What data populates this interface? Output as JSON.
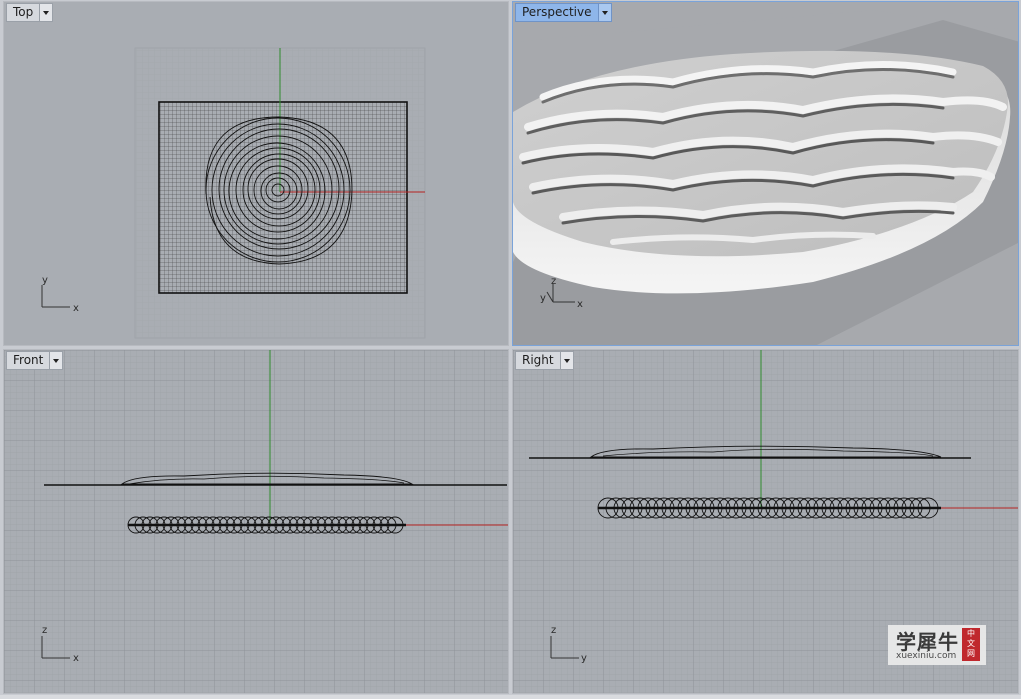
{
  "viewports": {
    "top": {
      "label": "Top",
      "axis_a": "y",
      "axis_b": "x"
    },
    "perspective": {
      "label": "Perspective",
      "axis_a": "z",
      "axis_b": "y",
      "axis_c": "x"
    },
    "front": {
      "label": "Front",
      "axis_a": "z",
      "axis_b": "x"
    },
    "right": {
      "label": "Right",
      "axis_a": "z",
      "axis_b": "y"
    }
  },
  "watermark": {
    "chinese": "学犀牛",
    "site": "xuexiniu.com",
    "badge": [
      "中",
      "文",
      "网"
    ]
  },
  "colors": {
    "x_axis": "#b52222",
    "y_axis": "#2e8a2e",
    "grid_minor": "#9ea2a8",
    "grid_major": "#8e9298",
    "active_border": "#7aa3d9"
  }
}
